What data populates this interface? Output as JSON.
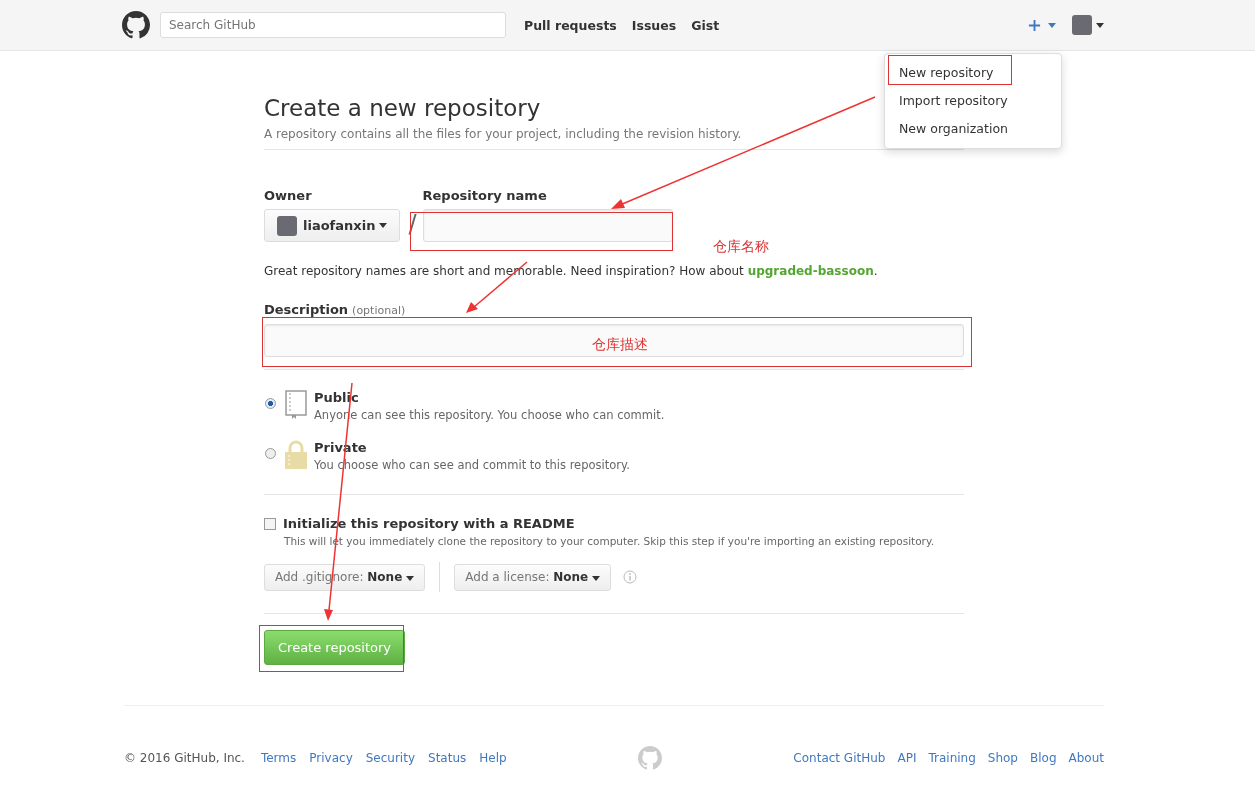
{
  "header": {
    "search": {
      "placeholder": "Search GitHub"
    },
    "nav": [
      "Pull requests",
      "Issues",
      "Gist"
    ]
  },
  "dropdown": {
    "items": [
      "New repository",
      "Import repository",
      "New organization"
    ]
  },
  "form": {
    "title": "Create a new repository",
    "subtitle": "A repository contains all the files for your project, including the revision history.",
    "owner_label": "Owner",
    "owner": "liaofanxin",
    "separator": "/",
    "name_label": "Repository name",
    "hint": "Great repository names are short and memorable. Need inspiration? How about **upgraded-bassoon**.",
    "description_label": "Description",
    "description_note": "(optional)",
    "visibility": [
      {
        "kind": "public",
        "title": "Public",
        "desc": "Anyone can see this repository. You choose who can commit.",
        "selected": true
      },
      {
        "kind": "private",
        "title": "Private",
        "desc": "You choose who can see and commit to this repository.",
        "selected": false
      }
    ],
    "readme": {
      "label": "Initialize this repository with a README",
      "desc": "This will let you immediately clone the repository to your computer. Skip this step if you're importing an existing repository.",
      "checked": false
    },
    "selects": [
      {
        "prefix": "Add .gitignore:",
        "value": "None"
      },
      {
        "prefix": "Add a license:",
        "value": "None"
      }
    ],
    "submit": "Create repository"
  },
  "annotations": {
    "labels": [
      "仓库名称",
      "仓库描述"
    ]
  },
  "footer": {
    "copyright": "© 2016 GitHub, Inc.",
    "left_links": [
      "Terms",
      "Privacy",
      "Security",
      "Status",
      "Help"
    ],
    "right_links": [
      "Contact GitHub",
      "API",
      "Training",
      "Shop",
      "Blog",
      "About"
    ]
  }
}
